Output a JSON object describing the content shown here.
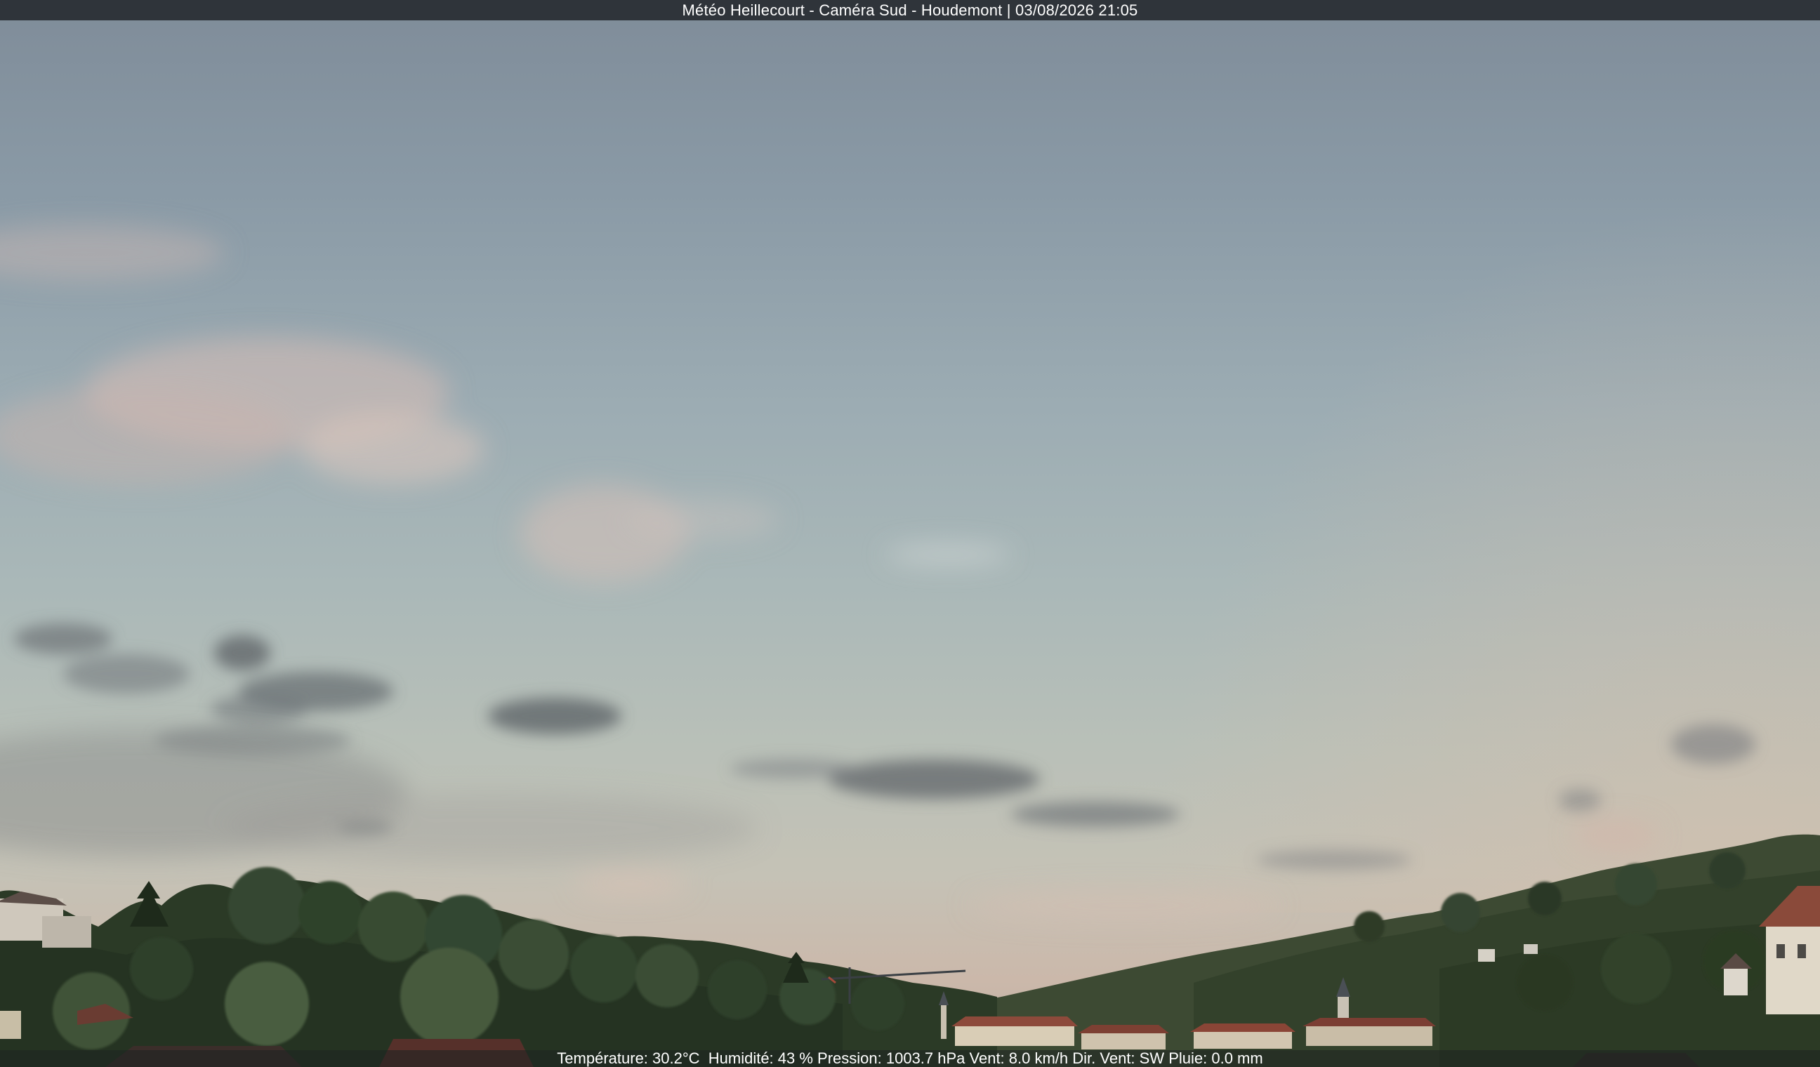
{
  "camera": {
    "title": "Météo Heillecourt - Caméra Sud - Houdemont | 03/08/2026 21:05"
  },
  "weather": {
    "readout": "Température: 30.2°C  Humidité: 43 % Pression: 1003.7 hPa Vent: 8.0 km/h Dir. Vent: SW Pluie: 0.0 mm",
    "temperature_c": 30.2,
    "humidity_pct": 43,
    "pressure_hpa": 1003.7,
    "wind_kmh": 8.0,
    "wind_direction": "SW",
    "rain_mm": 0.0
  },
  "scene": {
    "description_tags": [
      "evening-sky",
      "scattered-clouds",
      "tree-line",
      "hillside",
      "village-roofs",
      "tower-crane",
      "church-steeple"
    ],
    "colors": {
      "sky_top": "#7f8c99",
      "sky_horizon": "#cbb8aa",
      "cloud_dark": "#6f7478",
      "cloud_pink": "#d9bfb5",
      "foliage_dark": "#1f2a1c",
      "foliage_mid": "#34452d",
      "roof_red": "#8a4a3a",
      "wall_cream": "#d8cdb8"
    }
  }
}
